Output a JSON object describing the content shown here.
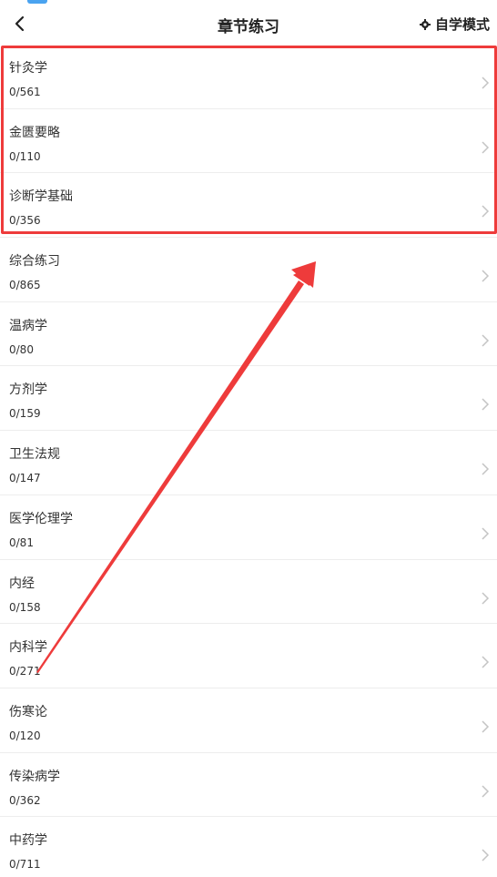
{
  "header": {
    "title": "章节练习",
    "mode_label": "自学模式"
  },
  "items": [
    {
      "name": "针灸学",
      "count": "0/561"
    },
    {
      "name": "金匮要略",
      "count": "0/110"
    },
    {
      "name": "诊断学基础",
      "count": "0/356"
    },
    {
      "name": "综合练习",
      "count": "0/865"
    },
    {
      "name": "温病学",
      "count": "0/80"
    },
    {
      "name": "方剂学",
      "count": "0/159"
    },
    {
      "name": "卫生法规",
      "count": "0/147"
    },
    {
      "name": "医学伦理学",
      "count": "0/81"
    },
    {
      "name": "内经",
      "count": "0/158"
    },
    {
      "name": "内科学",
      "count": "0/271"
    },
    {
      "name": "伤寒论",
      "count": "0/120"
    },
    {
      "name": "传染病学",
      "count": "0/362"
    },
    {
      "name": "中药学",
      "count": "0/711"
    }
  ],
  "colors": {
    "highlight": "#ee3b3b",
    "arrow": "#ee3b3b"
  },
  "icons": {
    "back": "chevron-left-icon",
    "mode": "gear-icon",
    "row": "chevron-right-icon"
  }
}
